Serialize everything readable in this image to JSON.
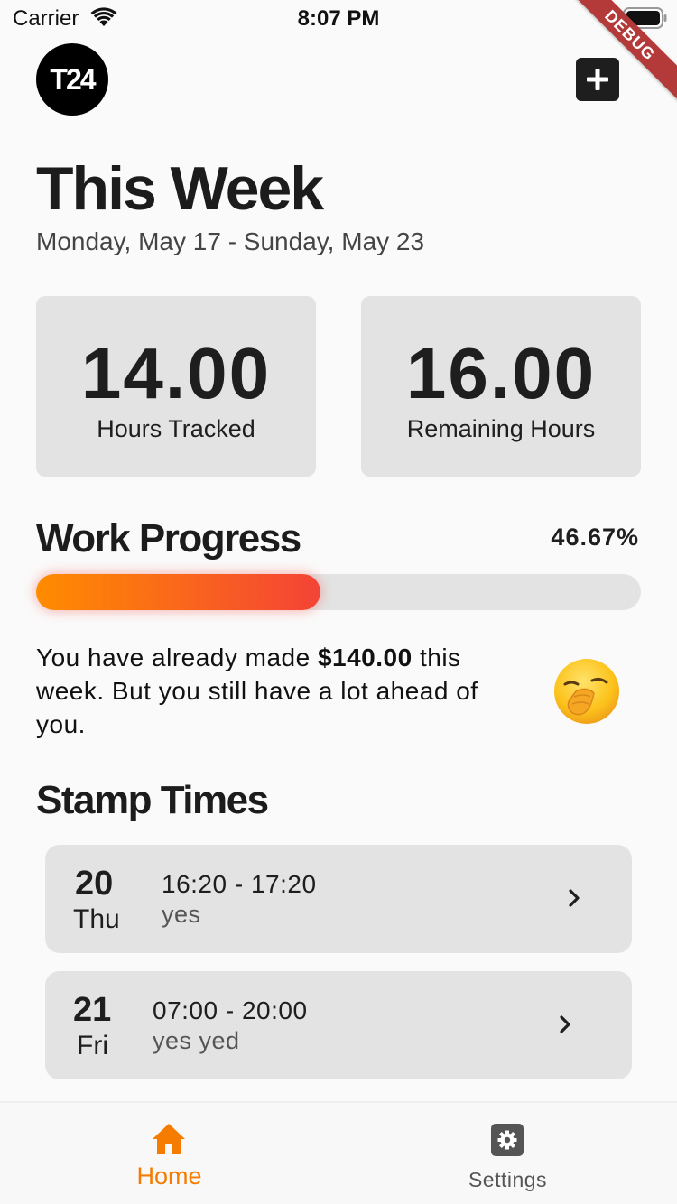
{
  "status_bar": {
    "carrier": "Carrier",
    "time": "8:07 PM"
  },
  "debug_banner": "DEBUG",
  "header": {
    "logo_text": "T24",
    "add_icon": "plus-icon"
  },
  "week": {
    "title": "This Week",
    "date_range": "Monday, May 17 - Sunday, May 23"
  },
  "stats": [
    {
      "value": "14.00",
      "label": "Hours Tracked"
    },
    {
      "value": "16.00",
      "label": "Remaining Hours"
    }
  ],
  "progress": {
    "title": "Work Progress",
    "percent_text": "46.67%",
    "fraction": 0.4667,
    "gradient": [
      "#ff8c00",
      "#f44336"
    ]
  },
  "earnings": {
    "prefix": "You have already made ",
    "amount": "$140.00",
    "suffix": " this week. But you still have a lot ahead of you.",
    "emoji": "yawning-face"
  },
  "stamp_times": {
    "title": "Stamp Times",
    "items": [
      {
        "day": "20",
        "weekday": "Thu",
        "range": "16:20 - 17:20",
        "note": "yes"
      },
      {
        "day": "21",
        "weekday": "Fri",
        "range": "07:00 - 20:00",
        "note": "yes yed"
      }
    ]
  },
  "bottom_nav": {
    "items": [
      {
        "label": "Home",
        "icon": "home-icon",
        "active": true
      },
      {
        "label": "Settings",
        "icon": "gear-icon",
        "active": false
      }
    ]
  },
  "colors": {
    "accent": "#f57c00",
    "card": "#e3e3e3",
    "background": "#fafafa"
  }
}
